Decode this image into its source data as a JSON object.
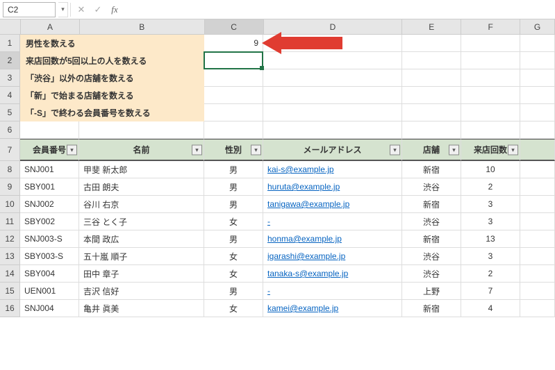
{
  "cellRef": "C2",
  "cols": [
    "A",
    "B",
    "C",
    "D",
    "E",
    "F",
    "G"
  ],
  "selColIdx": 2,
  "rows": [
    "1",
    "2",
    "3",
    "4",
    "5",
    "6",
    "7",
    "8",
    "9",
    "10",
    "11",
    "12",
    "13",
    "14",
    "15",
    "16"
  ],
  "selRowIdx": 1,
  "highlights": [
    "男性を数える",
    "来店回数が5回以上の人を数える",
    "「渋谷」以外の店舗を数える",
    "「新」で始まる店舗を数える",
    "「-S」で終わる会員番号を数える"
  ],
  "valC1": "9",
  "tableHeaders": [
    "会員番号",
    "名前",
    "性別",
    "メールアドレス",
    "店舗",
    "来店回数"
  ],
  "tableRows": [
    {
      "id": "SNJ001",
      "name": "甲斐 新太郎",
      "sex": "男",
      "mail": "kai-s@example.jp",
      "store": "新宿",
      "visits": "10"
    },
    {
      "id": "SBY001",
      "name": "古田 朗夫",
      "sex": "男",
      "mail": "huruta@example.jp",
      "store": "渋谷",
      "visits": "2"
    },
    {
      "id": "SNJ002",
      "name": "谷川 右京",
      "sex": "男",
      "mail": "tanigawa@example.jp",
      "store": "新宿",
      "visits": "3"
    },
    {
      "id": "SBY002",
      "name": "三谷 とく子",
      "sex": "女",
      "mail": "-",
      "store": "渋谷",
      "visits": "3"
    },
    {
      "id": "SNJ003-S",
      "name": "本間 政広",
      "sex": "男",
      "mail": "honma@example.jp",
      "store": "新宿",
      "visits": "13"
    },
    {
      "id": "SBY003-S",
      "name": "五十嵐 順子",
      "sex": "女",
      "mail": "igarashi@example.jp",
      "store": "渋谷",
      "visits": "3"
    },
    {
      "id": "SBY004",
      "name": "田中 章子",
      "sex": "女",
      "mail": "tanaka-s@example.jp",
      "store": "渋谷",
      "visits": "2"
    },
    {
      "id": "UEN001",
      "name": "吉沢 信好",
      "sex": "男",
      "mail": "-",
      "store": "上野",
      "visits": "7"
    },
    {
      "id": "SNJ004",
      "name": "亀井 眞美",
      "sex": "女",
      "mail": "kamei@example.jp",
      "store": "新宿",
      "visits": "4"
    }
  ]
}
